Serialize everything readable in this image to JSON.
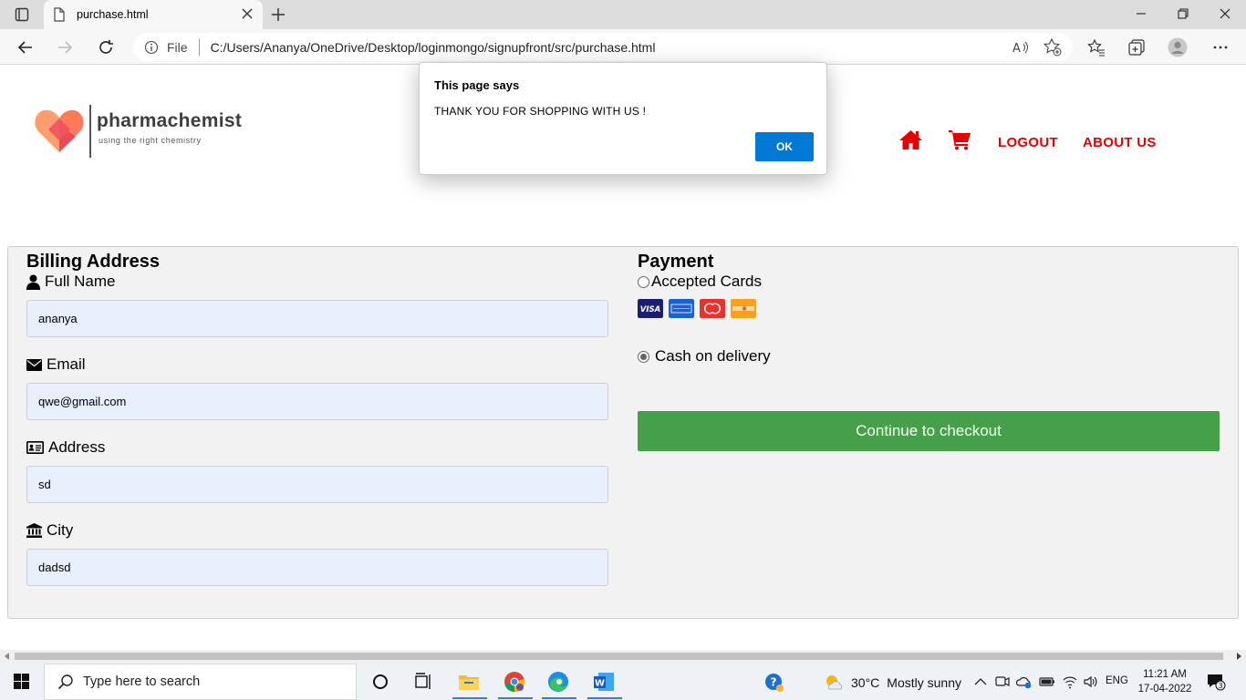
{
  "browser": {
    "tab_title": "purchase.html",
    "address_scheme": "File",
    "url": "C:/Users/Ananya/OneDrive/Desktop/loginmongo/signupfront/src/purchase.html"
  },
  "header": {
    "brand_name": "pharmachemist",
    "brand_tagline": "using the right chemistry",
    "nav": {
      "logout": "LOGOUT",
      "about": "ABOUT US"
    }
  },
  "billing": {
    "title": "Billing Address",
    "fields": [
      {
        "label": "Full Name",
        "value": "ananya"
      },
      {
        "label": "Email",
        "value": "qwe@gmail.com"
      },
      {
        "label": "Address",
        "value": "sd"
      },
      {
        "label": "City",
        "value": "dadsd"
      }
    ]
  },
  "payment": {
    "title": "Payment",
    "option_cards": "Accepted Cards",
    "option_cod": "Cash on delivery",
    "selected": "cod",
    "card_brands": [
      "visa",
      "amex",
      "mastercard",
      "discover"
    ],
    "checkout_label": "Continue to checkout"
  },
  "dialog": {
    "title": "This page says",
    "message": "THANK YOU FOR SHOPPING WITH US !",
    "ok_label": "OK"
  },
  "taskbar": {
    "search_placeholder": "Type here to search",
    "weather_temp": "30°C",
    "weather_text": "Mostly sunny",
    "language": "ENG",
    "time": "11:21 AM",
    "date": "17-04-2022",
    "notification_count": "3"
  },
  "colors": {
    "accent_red": "#e60000",
    "checkout_green": "#45a049",
    "input_fill": "#e8f0fe",
    "dialog_button": "#0078d4"
  }
}
